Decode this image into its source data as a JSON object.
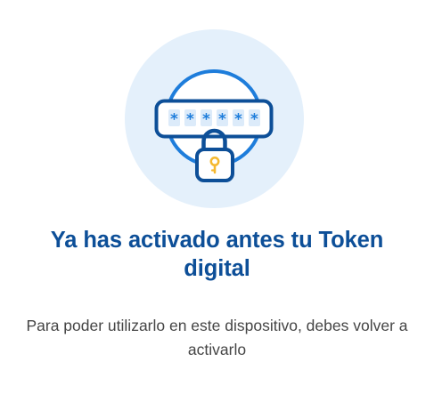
{
  "message": {
    "title": "Ya has activado antes tu Token digital",
    "body": "Para poder utilizarlo en este dispositivo, debes volver a activarlo"
  },
  "illustration": {
    "icon": "password-lock-icon",
    "masked_chars": [
      "*",
      "*",
      "*",
      "*",
      "*",
      "*"
    ]
  },
  "colors": {
    "primary_blue": "#0d4f98",
    "accent_blue": "#1e7ddb",
    "bg_circle": "#e4f0fb",
    "key_yellow": "#f5b82e",
    "body_text": "#454545"
  }
}
